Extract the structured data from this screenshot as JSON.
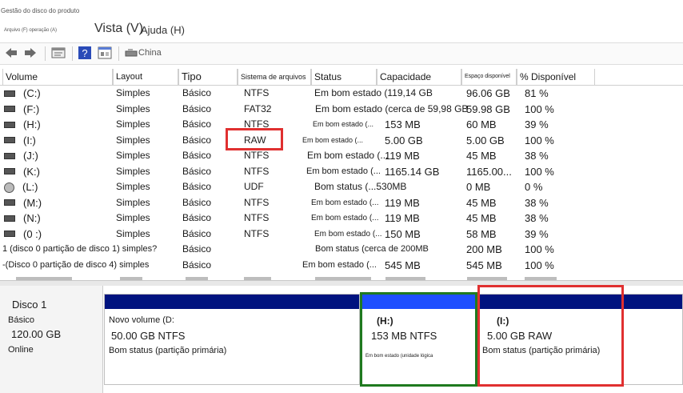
{
  "window": {
    "title": "Gestão do disco do produto",
    "menu_small": "Arquivo (F) operação (A)",
    "menu_view": "Vista (V)",
    "menu_help": "Ajuda (H)"
  },
  "toolbar": {
    "label": "China",
    "icons": [
      "back-arrow-icon",
      "forward-arrow-icon",
      "properties-icon",
      "help-icon",
      "console-icon",
      "refresh-icon"
    ]
  },
  "table": {
    "headers": {
      "volume": "Volume",
      "layout": "Layout",
      "tipo": "Tipo",
      "fs": "Sistema de arquivos",
      "status": "Status",
      "capacidade": "Capacidade",
      "espaco": "Espaço disponível",
      "pct": "% Disponível"
    },
    "rows": [
      {
        "vol": "(C:)",
        "layout": "Simples",
        "tipo": "Básico",
        "fs": "NTFS",
        "status": "Em bom estado (119,14 GB",
        "cap": "",
        "free": "96.06 GB",
        "pct": "81 %"
      },
      {
        "vol": "(F:)",
        "layout": "Simples",
        "tipo": "Básico",
        "fs": "FAT32",
        "status": "Em bom estado (cerca de 59,98 GB",
        "cap": "",
        "free": "59.98 GB",
        "pct": "100 %"
      },
      {
        "vol": "(H:)",
        "layout": "Simples",
        "tipo": "Básico",
        "fs": "NTFS",
        "status": "Em bom estado (...",
        "cap": "153 MB",
        "free": "60 MB",
        "pct": "39 %"
      },
      {
        "vol": "(I:)",
        "layout": "Simples",
        "tipo": "Básico",
        "fs": "RAW",
        "status": "Em bom estado (...",
        "cap": "5.00 GB",
        "free": "5.00 GB",
        "pct": "100 %"
      },
      {
        "vol": "(J:)",
        "layout": "Simples",
        "tipo": "Básico",
        "fs": "NTFS",
        "status": "Em bom estado (...",
        "cap": "119 MB",
        "free": "45 MB",
        "pct": "38 %"
      },
      {
        "vol": "(K:)",
        "layout": "Simples",
        "tipo": "Básico",
        "fs": "NTFS",
        "status": "Em bom estado (...",
        "cap": "1165.14 GB",
        "free": "1165.00...",
        "pct": "100 %"
      },
      {
        "vol": "(L:)",
        "layout": "Simples",
        "tipo": "Básico",
        "fs": "UDF",
        "status": "Bom status (...530MB",
        "cap": "",
        "free": "0 MB",
        "pct": "0 %"
      },
      {
        "vol": "(M:)",
        "layout": "Simples",
        "tipo": "Básico",
        "fs": "NTFS",
        "status": "Em bom estado (...",
        "cap": "119 MB",
        "free": "45 MB",
        "pct": "38 %"
      },
      {
        "vol": "(N:)",
        "layout": "Simples",
        "tipo": "Básico",
        "fs": "NTFS",
        "status": "Em bom estado (...",
        "cap": "119 MB",
        "free": "45 MB",
        "pct": "38 %"
      },
      {
        "vol": "(0 :)",
        "layout": "Simples",
        "tipo": "Básico",
        "fs": "NTFS",
        "status": "Em bom estado (...",
        "cap": "150 MB",
        "free": "58 MB",
        "pct": "39 %"
      },
      {
        "vol": "1 (disco 0 partição de disco 1) simples?",
        "layout": "",
        "tipo": "Básico",
        "fs": "",
        "status": "Bom status (cerca de 200MB",
        "cap": "",
        "free": "200 MB",
        "pct": "100 %"
      },
      {
        "vol": "-(Disco 0 partição de disco 4) simples",
        "layout": "",
        "tipo": "Básico",
        "fs": "",
        "status": "Em bom estado (...",
        "cap": "545 MB",
        "free": "545 MB",
        "pct": "100 %"
      }
    ]
  },
  "disk": {
    "name": "Disco 1",
    "type": "Básico",
    "size": "120.00 GB",
    "state": "Online",
    "partitions": [
      {
        "title": "Novo volume (D:",
        "size": "50.00 GB NTFS",
        "status": "Bom status (partição primária)"
      },
      {
        "title": "(H:)",
        "size": "153 MB NTFS",
        "status": "Em bom estado (unidade lógica"
      },
      {
        "title": "(I:)",
        "size": "5.00 GB RAW",
        "status": "Bom status (partição primária)"
      }
    ]
  }
}
